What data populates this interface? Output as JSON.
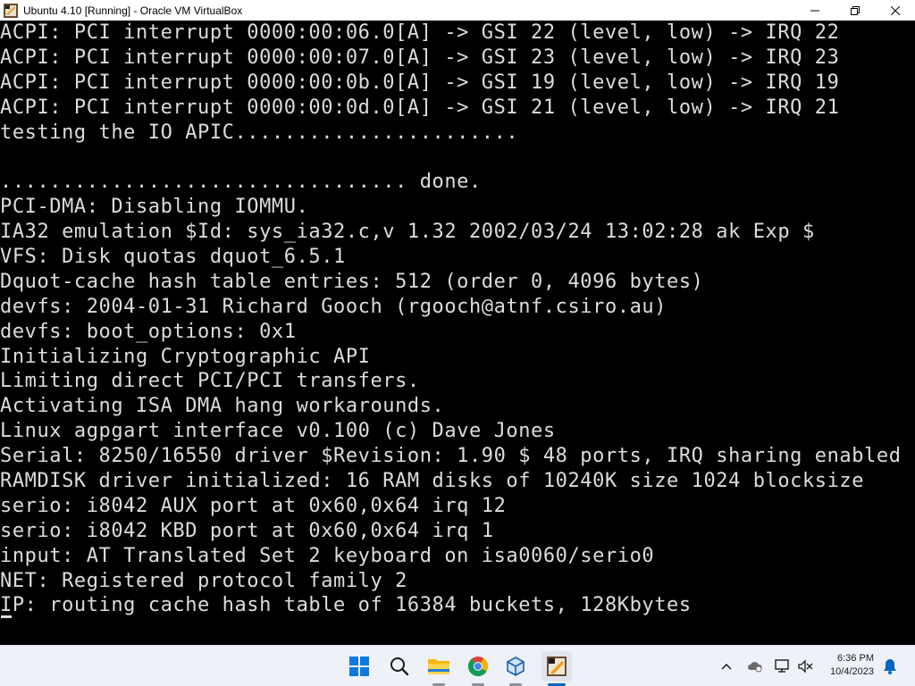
{
  "window": {
    "title": "Ubuntu 4.10 [Running] - Oracle VM VirtualBox"
  },
  "console": {
    "lines": [
      "ACPI: PCI interrupt 0000:00:06.0[A] -> GSI 22 (level, low) -> IRQ 22",
      "ACPI: PCI interrupt 0000:00:07.0[A] -> GSI 23 (level, low) -> IRQ 23",
      "ACPI: PCI interrupt 0000:00:0b.0[A] -> GSI 19 (level, low) -> IRQ 19",
      "ACPI: PCI interrupt 0000:00:0d.0[A] -> GSI 21 (level, low) -> IRQ 21",
      "testing the IO APIC.......................",
      "",
      "................................. done.",
      "PCI-DMA: Disabling IOMMU.",
      "IA32 emulation $Id: sys_ia32.c,v 1.32 2002/03/24 13:02:28 ak Exp $",
      "VFS: Disk quotas dquot_6.5.1",
      "Dquot-cache hash table entries: 512 (order 0, 4096 bytes)",
      "devfs: 2004-01-31 Richard Gooch (rgooch@atnf.csiro.au)",
      "devfs: boot_options: 0x1",
      "Initializing Cryptographic API",
      "Limiting direct PCI/PCI transfers.",
      "Activating ISA DMA hang workarounds.",
      "Linux agpgart interface v0.100 (c) Dave Jones",
      "Serial: 8250/16550 driver $Revision: 1.90 $ 48 ports, IRQ sharing enabled",
      "RAMDISK driver initialized: 16 RAM disks of 10240K size 1024 blocksize",
      "serio: i8042 AUX port at 0x60,0x64 irq 12",
      "serio: i8042 KBD port at 0x60,0x64 irq 1",
      "input: AT Translated Set 2 keyboard on isa0060/serio0",
      "NET: Registered protocol family 2",
      "IP: routing cache hash table of 16384 buckets, 128Kbytes"
    ]
  },
  "taskbar": {
    "apps": [
      {
        "name": "start-button-icon"
      },
      {
        "name": "search-icon"
      },
      {
        "name": "file-explorer-icon"
      },
      {
        "name": "chrome-icon"
      },
      {
        "name": "virtualbox-icon"
      },
      {
        "name": "virtualbox-vm-icon"
      }
    ],
    "tray": [
      "chevron-up-icon",
      "onedrive-icon",
      "network-icon",
      "volume-muted-icon",
      "notification-bell-icon"
    ],
    "clock": {
      "time": "6:36 PM",
      "date": "10/4/2023"
    }
  },
  "colors": {
    "console_text": "#dcdcdc",
    "console_bg": "#000000",
    "taskbar_bg": "#eef1f8",
    "accent": "#0067c0"
  }
}
